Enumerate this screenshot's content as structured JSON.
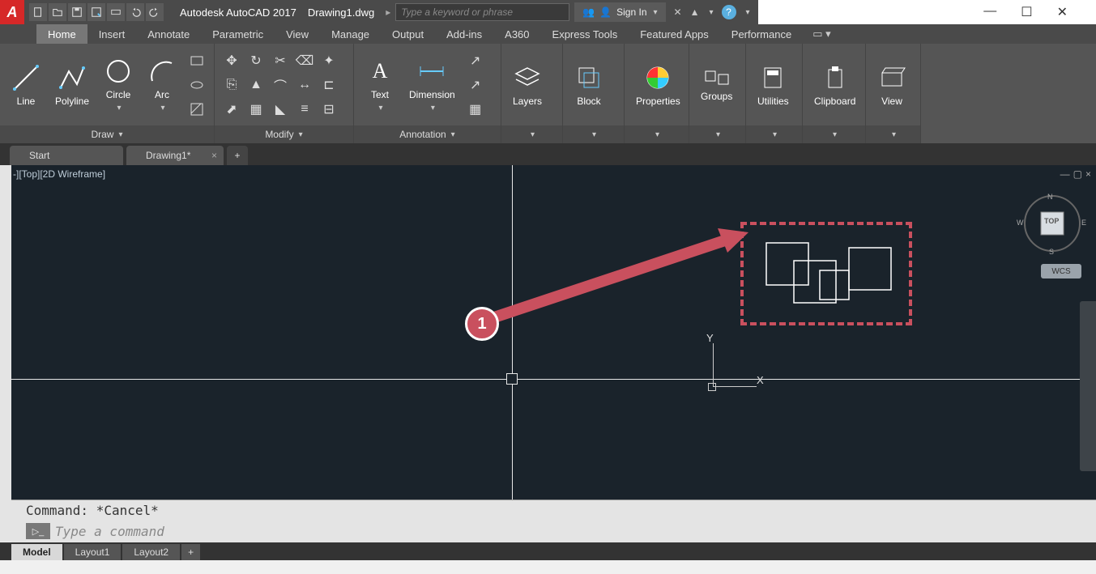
{
  "title": {
    "app": "Autodesk AutoCAD 2017",
    "document": "Drawing1.dwg",
    "search_placeholder": "Type a keyword or phrase",
    "signin": "Sign In"
  },
  "ribbon_tabs": [
    "Home",
    "Insert",
    "Annotate",
    "Parametric",
    "View",
    "Manage",
    "Output",
    "Add-ins",
    "A360",
    "Express Tools",
    "Featured Apps",
    "Performance"
  ],
  "active_ribbon_tab": "Home",
  "panels": {
    "draw": {
      "title": "Draw",
      "tools": [
        "Line",
        "Polyline",
        "Circle",
        "Arc"
      ]
    },
    "modify": {
      "title": "Modify"
    },
    "annotation": {
      "title": "Annotation",
      "tools": [
        "Text",
        "Dimension"
      ]
    },
    "layers": "Layers",
    "block": "Block",
    "properties": "Properties",
    "groups": "Groups",
    "utilities": "Utilities",
    "clipboard": "Clipboard",
    "view": "View"
  },
  "doc_tabs": {
    "start": "Start",
    "drawing": "Drawing1*"
  },
  "viewport": {
    "label": "-][Top][2D Wireframe]",
    "ucs_y": "Y",
    "ucs_x": "X",
    "wcs": "WCS",
    "cube_face": "TOP",
    "compass": {
      "n": "N",
      "e": "E",
      "s": "S",
      "w": "W"
    }
  },
  "annotation_marker": "1",
  "command": {
    "history": "Command: *Cancel*",
    "placeholder": "Type a command"
  },
  "status_tabs": [
    "Model",
    "Layout1",
    "Layout2"
  ],
  "active_status_tab": "Model"
}
